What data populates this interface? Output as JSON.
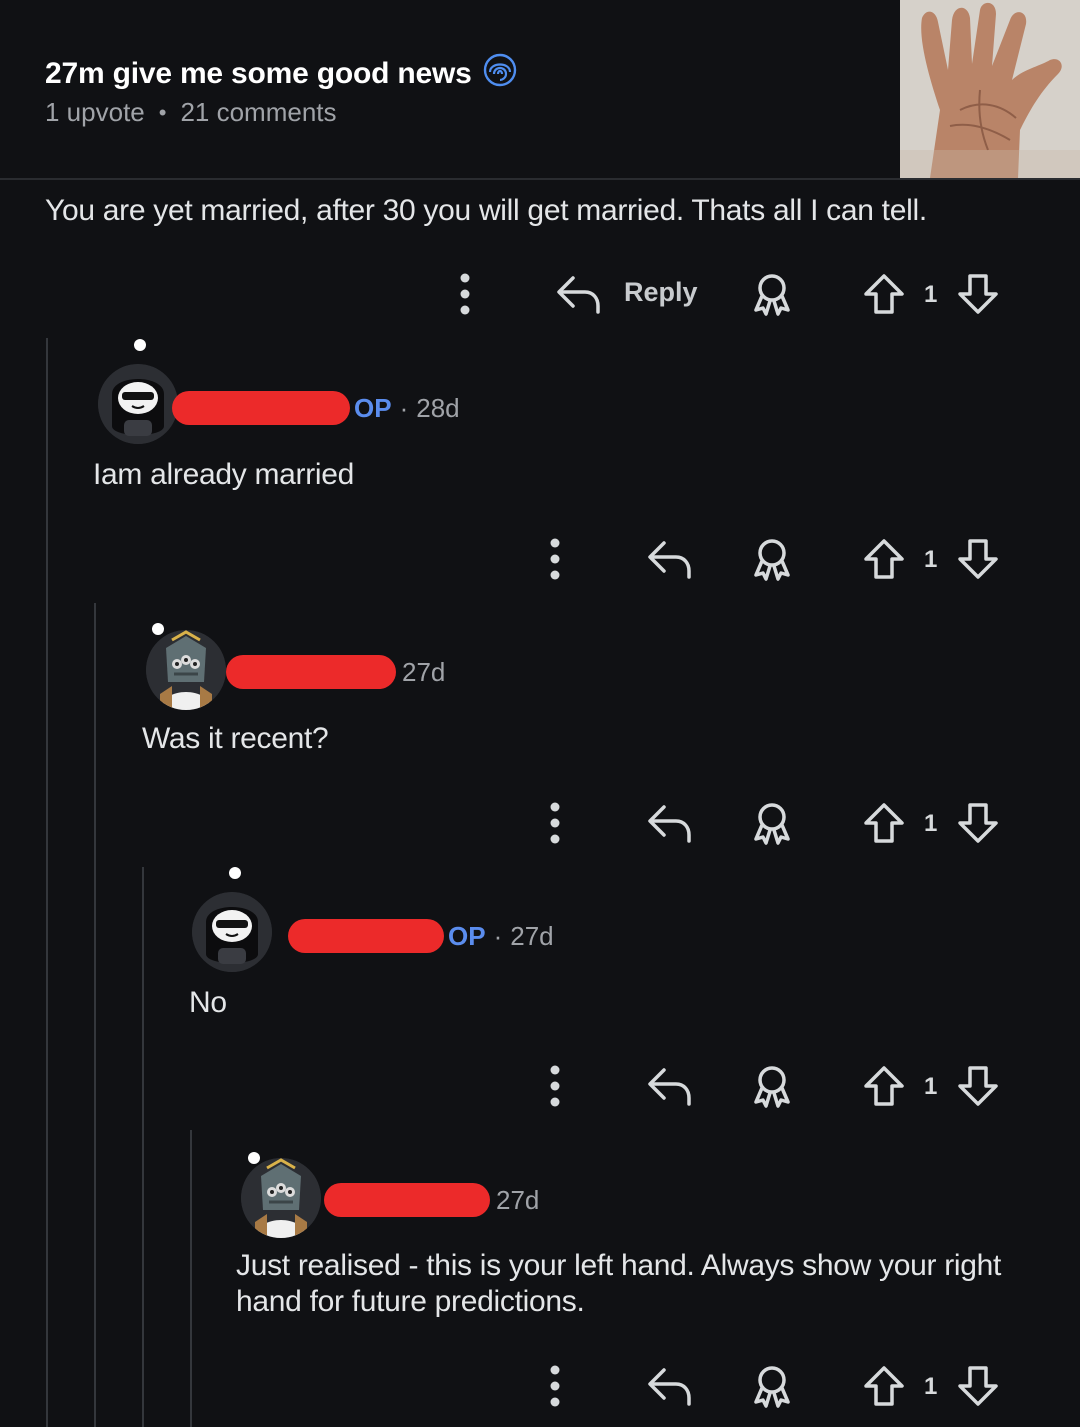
{
  "post": {
    "title": "27m give me some good news",
    "upvotes": "1 upvote",
    "comments": "21 comments"
  },
  "comments": [
    {
      "text": "You are yet married, after 30 you will get married. Thats all I can tell.",
      "reply_label": "Reply",
      "votes": "1"
    },
    {
      "op": "OP",
      "age": "28d",
      "text": "Iam already married",
      "votes": "1"
    },
    {
      "age": "27d",
      "text": "Was it recent?",
      "votes": "1"
    },
    {
      "op": "OP",
      "age": "27d",
      "text": "No",
      "votes": "1"
    },
    {
      "age": "27d",
      "text": "Just realised - this is your left hand. Always show your right hand for future predictions.",
      "votes": "1"
    }
  ],
  "colors": {
    "background": "#101114",
    "op_accent": "#5b8dee",
    "redaction": "#ec2a2a",
    "text": "#e4e6e8",
    "muted": "#a0a3a8"
  }
}
